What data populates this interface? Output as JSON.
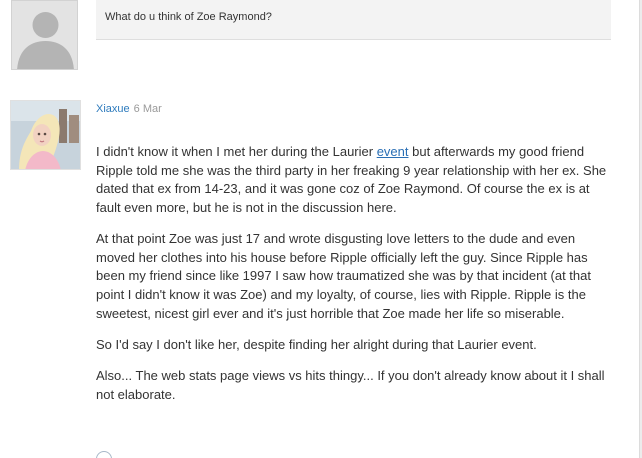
{
  "question": {
    "text": "What do u think of Zoe Raymond?"
  },
  "comment": {
    "author": "Xiaxue",
    "date": "6 Mar",
    "p1_before": "I didn't know it when I met her during the Laurier ",
    "p1_link": "event",
    "p1_after": " but afterwards my good friend Ripple told me she was the third party in her freaking 9 year relationship with her ex. She dated that ex from 14-23, and it was gone coz of Zoe Raymond. Of course the ex is at fault even more, but he is not in the discussion here.",
    "p2": "At that point Zoe was just 17 and wrote disgusting love letters to the dude and even moved her clothes into his house before Ripple officially left the guy. Since Ripple has been my friend since like 1997 I saw how traumatized she was by that incident (at that point I didn't know it was Zoe) and my loyalty, of course, lies with Ripple. Ripple is the sweetest, nicest girl ever and it's just horrible that Zoe made her life so miserable.",
    "p3": "So I'd say I don't like her, despite finding her alright during that Laurier event.",
    "p4": "Also... The web stats page views vs hits thingy... If you don't already know about it I shall not elaborate."
  },
  "icons": {
    "question_avatar": "default-user-silhouette-icon",
    "comment_avatar": "user-photo",
    "reply": "circle-icon"
  },
  "colors": {
    "author_link": "#2e7bbd",
    "inline_link": "#2a6fb5",
    "question_box_bg": "#f3f3f3",
    "avatar_placeholder_bg": "#e3e3e3"
  }
}
